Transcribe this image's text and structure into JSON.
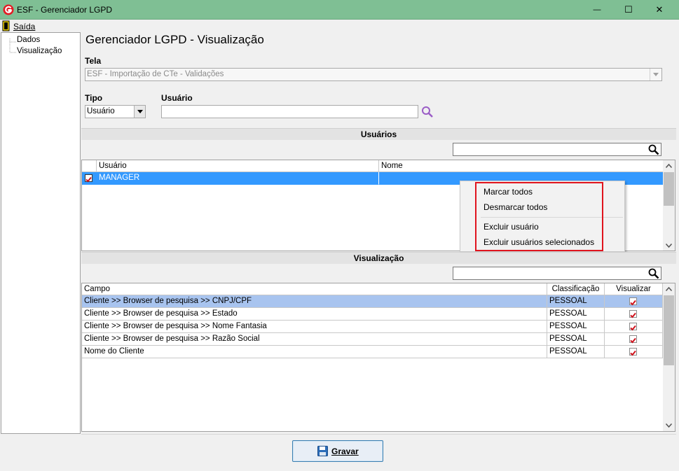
{
  "window": {
    "title": "ESF - Gerenciador LGPD",
    "minimize": "—",
    "maximize": "☐",
    "close": "✕"
  },
  "menu": {
    "sair": "Saída"
  },
  "tree": {
    "items": [
      "Dados",
      "Visualização"
    ]
  },
  "page": {
    "title": "Gerenciador LGPD - Visualização"
  },
  "tela": {
    "label": "Tela",
    "value": "ESF - Importação de CTe - Validações"
  },
  "tipo": {
    "label": "Tipo",
    "value": "Usuário"
  },
  "usuario": {
    "label": "Usuário",
    "value": ""
  },
  "usuarios_section": {
    "title": "Usuários",
    "columns": [
      "Usuário",
      "Nome"
    ],
    "rows": [
      {
        "usuario": "MANAGER",
        "nome": "",
        "checked": true,
        "selected": true
      }
    ]
  },
  "context_menu": {
    "items": [
      "Marcar todos",
      "Desmarcar todos",
      "Excluir usuário",
      "Excluir usuários selecionados"
    ]
  },
  "visualizacao_section": {
    "title": "Visualização",
    "columns": [
      "Campo",
      "Classificação",
      "Visualizar"
    ],
    "rows": [
      {
        "campo": "Cliente >> Browser de pesquisa >> CNPJ/CPF",
        "classificacao": "PESSOAL",
        "visualizar": true,
        "selected": true
      },
      {
        "campo": "Cliente >> Browser de pesquisa >> Estado",
        "classificacao": "PESSOAL",
        "visualizar": true,
        "selected": false
      },
      {
        "campo": "Cliente >> Browser de pesquisa >> Nome Fantasia",
        "classificacao": "PESSOAL",
        "visualizar": true,
        "selected": false
      },
      {
        "campo": "Cliente >> Browser de pesquisa >> Razão Social",
        "classificacao": "PESSOAL",
        "visualizar": true,
        "selected": false
      },
      {
        "campo": "Nome do Cliente",
        "classificacao": "PESSOAL",
        "visualizar": true,
        "selected": false
      }
    ]
  },
  "save_button": {
    "label": "Gravar"
  },
  "colors": {
    "titlebar": "#7fbf94",
    "selection_blue": "#3399ff",
    "selection_light": "#a8c4ef",
    "highlight_red": "#e0141e",
    "check_red": "#d0141e"
  }
}
